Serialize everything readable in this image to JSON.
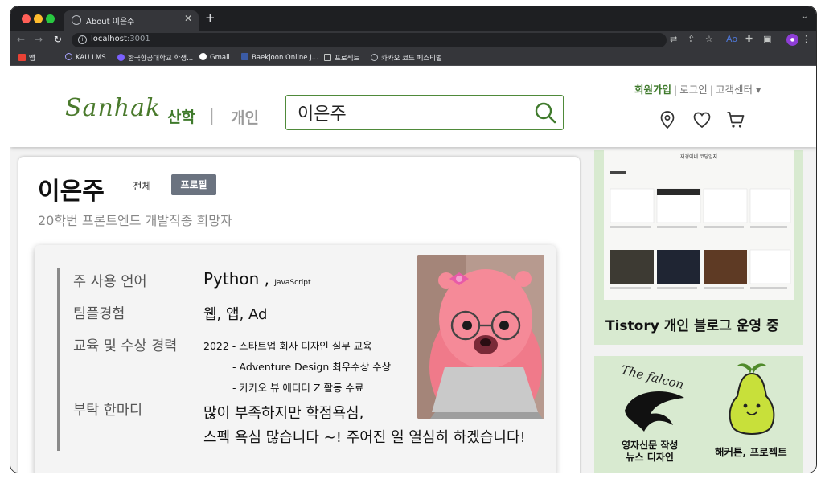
{
  "browser": {
    "tab_title": "About 이은주",
    "url_host": "localhost",
    "url_port": ":3001",
    "bookmarks": [
      "앱",
      "KAU LMS",
      "한국항공대학교 학생...",
      "Gmail",
      "Baekjoon Online J...",
      "프로젝트",
      "카카오 코드 페스티벌"
    ]
  },
  "header": {
    "logo": "Sanhak",
    "nav_sanhak": "산학",
    "nav_sep": "|",
    "nav_personal": "개인",
    "search_value": "이은주",
    "auth_join": "회원가입",
    "auth_login": "로그인",
    "auth_support": "고객센터 ▾",
    "auth_sep": "|"
  },
  "profile": {
    "name": "이은주",
    "filter_all": "전체",
    "filter_profile": "프로필",
    "subtitle": "20학번 프론트엔드 개발직종 희망자",
    "rows": {
      "lang_label": "주 사용 언어",
      "lang_main": "Python ,",
      "lang_sub": "JavaScript",
      "team_label": "팀플경험",
      "team_value": "웹, 앱, Ad",
      "edu_label": "교육 및 수상 경력",
      "edu_1": "2022 - 스타트업 회사 디자인 실무 교육",
      "edu_2": "- Adventure Design 최우수상 수상",
      "edu_3": "- 카카오 뷰 에디터 Z 활동 수료",
      "word_label": "부탁 한마디",
      "word_1": "많이 부족하지만 학점욕심,",
      "word_2": "스펙 욕심 많습니다 ~! 주어진 일 열심히 하겠습니다!"
    }
  },
  "sidebar": {
    "blog_header": "재경이네 코딩일지",
    "blog_caption": "Tistory 개인 블로그 운영 중",
    "falcon_text": "The falcon",
    "news_line1": "영자신문 작성",
    "news_line2": "뉴스 디자인",
    "hack_label": "해커톤, 프로젝트"
  },
  "colors": {
    "brand_green": "#3f7a2c",
    "card_green": "#d8ead0",
    "profile_tag": "#6b7380"
  }
}
